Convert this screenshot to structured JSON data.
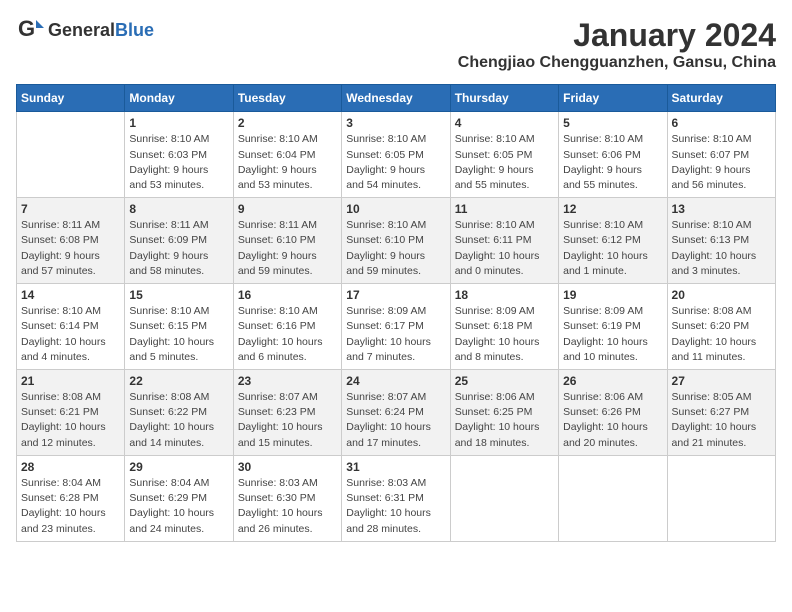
{
  "header": {
    "logo_general": "General",
    "logo_blue": "Blue",
    "title": "January 2024",
    "subtitle": "Chengjiao Chengguanzhen, Gansu, China"
  },
  "calendar": {
    "days_of_week": [
      "Sunday",
      "Monday",
      "Tuesday",
      "Wednesday",
      "Thursday",
      "Friday",
      "Saturday"
    ],
    "weeks": [
      [
        {
          "day": "",
          "info": ""
        },
        {
          "day": "1",
          "info": "Sunrise: 8:10 AM\nSunset: 6:03 PM\nDaylight: 9 hours\nand 53 minutes."
        },
        {
          "day": "2",
          "info": "Sunrise: 8:10 AM\nSunset: 6:04 PM\nDaylight: 9 hours\nand 53 minutes."
        },
        {
          "day": "3",
          "info": "Sunrise: 8:10 AM\nSunset: 6:05 PM\nDaylight: 9 hours\nand 54 minutes."
        },
        {
          "day": "4",
          "info": "Sunrise: 8:10 AM\nSunset: 6:05 PM\nDaylight: 9 hours\nand 55 minutes."
        },
        {
          "day": "5",
          "info": "Sunrise: 8:10 AM\nSunset: 6:06 PM\nDaylight: 9 hours\nand 55 minutes."
        },
        {
          "day": "6",
          "info": "Sunrise: 8:10 AM\nSunset: 6:07 PM\nDaylight: 9 hours\nand 56 minutes."
        }
      ],
      [
        {
          "day": "7",
          "info": "Sunrise: 8:11 AM\nSunset: 6:08 PM\nDaylight: 9 hours\nand 57 minutes."
        },
        {
          "day": "8",
          "info": "Sunrise: 8:11 AM\nSunset: 6:09 PM\nDaylight: 9 hours\nand 58 minutes."
        },
        {
          "day": "9",
          "info": "Sunrise: 8:11 AM\nSunset: 6:10 PM\nDaylight: 9 hours\nand 59 minutes."
        },
        {
          "day": "10",
          "info": "Sunrise: 8:10 AM\nSunset: 6:10 PM\nDaylight: 9 hours\nand 59 minutes."
        },
        {
          "day": "11",
          "info": "Sunrise: 8:10 AM\nSunset: 6:11 PM\nDaylight: 10 hours\nand 0 minutes."
        },
        {
          "day": "12",
          "info": "Sunrise: 8:10 AM\nSunset: 6:12 PM\nDaylight: 10 hours\nand 1 minute."
        },
        {
          "day": "13",
          "info": "Sunrise: 8:10 AM\nSunset: 6:13 PM\nDaylight: 10 hours\nand 3 minutes."
        }
      ],
      [
        {
          "day": "14",
          "info": "Sunrise: 8:10 AM\nSunset: 6:14 PM\nDaylight: 10 hours\nand 4 minutes."
        },
        {
          "day": "15",
          "info": "Sunrise: 8:10 AM\nSunset: 6:15 PM\nDaylight: 10 hours\nand 5 minutes."
        },
        {
          "day": "16",
          "info": "Sunrise: 8:10 AM\nSunset: 6:16 PM\nDaylight: 10 hours\nand 6 minutes."
        },
        {
          "day": "17",
          "info": "Sunrise: 8:09 AM\nSunset: 6:17 PM\nDaylight: 10 hours\nand 7 minutes."
        },
        {
          "day": "18",
          "info": "Sunrise: 8:09 AM\nSunset: 6:18 PM\nDaylight: 10 hours\nand 8 minutes."
        },
        {
          "day": "19",
          "info": "Sunrise: 8:09 AM\nSunset: 6:19 PM\nDaylight: 10 hours\nand 10 minutes."
        },
        {
          "day": "20",
          "info": "Sunrise: 8:08 AM\nSunset: 6:20 PM\nDaylight: 10 hours\nand 11 minutes."
        }
      ],
      [
        {
          "day": "21",
          "info": "Sunrise: 8:08 AM\nSunset: 6:21 PM\nDaylight: 10 hours\nand 12 minutes."
        },
        {
          "day": "22",
          "info": "Sunrise: 8:08 AM\nSunset: 6:22 PM\nDaylight: 10 hours\nand 14 minutes."
        },
        {
          "day": "23",
          "info": "Sunrise: 8:07 AM\nSunset: 6:23 PM\nDaylight: 10 hours\nand 15 minutes."
        },
        {
          "day": "24",
          "info": "Sunrise: 8:07 AM\nSunset: 6:24 PM\nDaylight: 10 hours\nand 17 minutes."
        },
        {
          "day": "25",
          "info": "Sunrise: 8:06 AM\nSunset: 6:25 PM\nDaylight: 10 hours\nand 18 minutes."
        },
        {
          "day": "26",
          "info": "Sunrise: 8:06 AM\nSunset: 6:26 PM\nDaylight: 10 hours\nand 20 minutes."
        },
        {
          "day": "27",
          "info": "Sunrise: 8:05 AM\nSunset: 6:27 PM\nDaylight: 10 hours\nand 21 minutes."
        }
      ],
      [
        {
          "day": "28",
          "info": "Sunrise: 8:04 AM\nSunset: 6:28 PM\nDaylight: 10 hours\nand 23 minutes."
        },
        {
          "day": "29",
          "info": "Sunrise: 8:04 AM\nSunset: 6:29 PM\nDaylight: 10 hours\nand 24 minutes."
        },
        {
          "day": "30",
          "info": "Sunrise: 8:03 AM\nSunset: 6:30 PM\nDaylight: 10 hours\nand 26 minutes."
        },
        {
          "day": "31",
          "info": "Sunrise: 8:03 AM\nSunset: 6:31 PM\nDaylight: 10 hours\nand 28 minutes."
        },
        {
          "day": "",
          "info": ""
        },
        {
          "day": "",
          "info": ""
        },
        {
          "day": "",
          "info": ""
        }
      ]
    ]
  }
}
